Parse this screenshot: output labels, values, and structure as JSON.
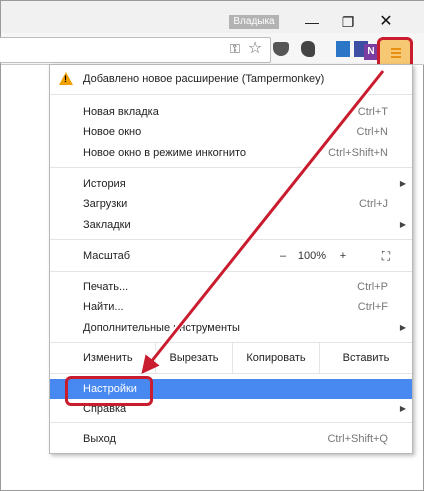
{
  "window": {
    "profile_name": "Владыка",
    "minimize_glyph": "—",
    "maximize_glyph": "❐",
    "close_glyph": "✕"
  },
  "toolbar": {
    "icons": [
      "key-icon",
      "star-icon",
      "pocket-icon",
      "evernote-icon",
      "box-icon",
      "mail-icon",
      "onenote-icon",
      "menu-icon"
    ],
    "onenote_letter": "N"
  },
  "menu": {
    "notice": "Добавлено новое расширение (Tampermonkey)",
    "new_tab": {
      "label": "Новая вкладка",
      "shortcut": "Ctrl+T"
    },
    "new_window": {
      "label": "Новое окно",
      "shortcut": "Ctrl+N"
    },
    "incognito": {
      "label": "Новое окно в режиме инкогнито",
      "shortcut": "Ctrl+Shift+N"
    },
    "history": {
      "label": "История"
    },
    "downloads": {
      "label": "Загрузки",
      "shortcut": "Ctrl+J"
    },
    "bookmarks": {
      "label": "Закладки"
    },
    "zoom": {
      "label": "Масштаб",
      "minus": "–",
      "value": "100%",
      "plus": "+"
    },
    "print": {
      "label": "Печать...",
      "shortcut": "Ctrl+P"
    },
    "find": {
      "label": "Найти...",
      "shortcut": "Ctrl+F"
    },
    "more_tools": {
      "label": "Дополнительные инструменты"
    },
    "edit": {
      "label": "Изменить",
      "cut": "Вырезать",
      "copy": "Копировать",
      "paste": "Вставить"
    },
    "settings": {
      "label": "Настройки"
    },
    "help": {
      "label": "Справка"
    },
    "exit": {
      "label": "Выход",
      "shortcut": "Ctrl+Shift+Q"
    }
  },
  "colors": {
    "highlight": "#4889f1",
    "callout": "#c91c2e",
    "warning": "#f0a000"
  }
}
